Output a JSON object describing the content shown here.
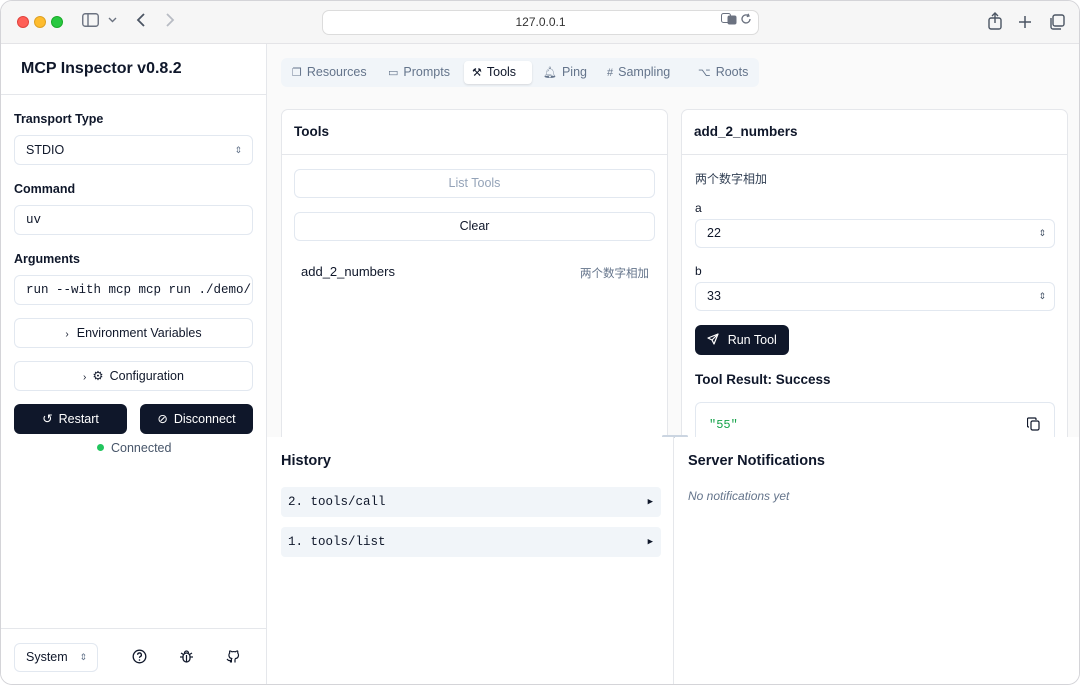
{
  "browser": {
    "url": "127.0.0.1",
    "icons": [
      "sidebar-icon",
      "chevron-down-icon",
      "back-icon",
      "forward-icon",
      "translate-icon",
      "reload-icon",
      "share-icon",
      "plus-icon",
      "tabs-icon"
    ]
  },
  "sidebar": {
    "title": "MCP Inspector v0.8.2",
    "transport_label": "Transport Type",
    "transport_value": "STDIO",
    "command_label": "Command",
    "command_value": "uv",
    "arguments_label": "Arguments",
    "arguments_value": "run --with mcp mcp run ./demo/",
    "env_button": "Environment Variables",
    "config_button": "Configuration",
    "restart_button": "Restart",
    "disconnect_button": "Disconnect",
    "status": "Connected",
    "status_color": "#22c55e",
    "theme_value": "System"
  },
  "tabs": [
    {
      "label": "Resources",
      "icon": "files-icon",
      "active": false
    },
    {
      "label": "Prompts",
      "icon": "message-icon",
      "active": false
    },
    {
      "label": "Tools",
      "icon": "hammer-icon",
      "active": true
    },
    {
      "label": "Ping",
      "icon": "bell-icon",
      "active": false
    },
    {
      "label": "Sampling",
      "icon": "hash-icon",
      "active": false
    },
    {
      "label": "Roots",
      "icon": "folder-tree-icon",
      "active": false
    }
  ],
  "tools_panel": {
    "title": "Tools",
    "list_button": "List Tools",
    "clear_button": "Clear",
    "tools": [
      {
        "name": "add_2_numbers",
        "description": "两个数字相加"
      }
    ]
  },
  "tool_detail": {
    "title": "add_2_numbers",
    "description": "两个数字相加",
    "param_a_label": "a",
    "param_a_value": "22",
    "param_b_label": "b",
    "param_b_value": "33",
    "run_button": "Run Tool",
    "result_label": "Tool Result: Success",
    "result_value": "\"55\""
  },
  "history": {
    "title": "History",
    "items": [
      "2. tools/call",
      "1. tools/list"
    ]
  },
  "notifications": {
    "title": "Server Notifications",
    "empty_text": "No notifications yet"
  }
}
